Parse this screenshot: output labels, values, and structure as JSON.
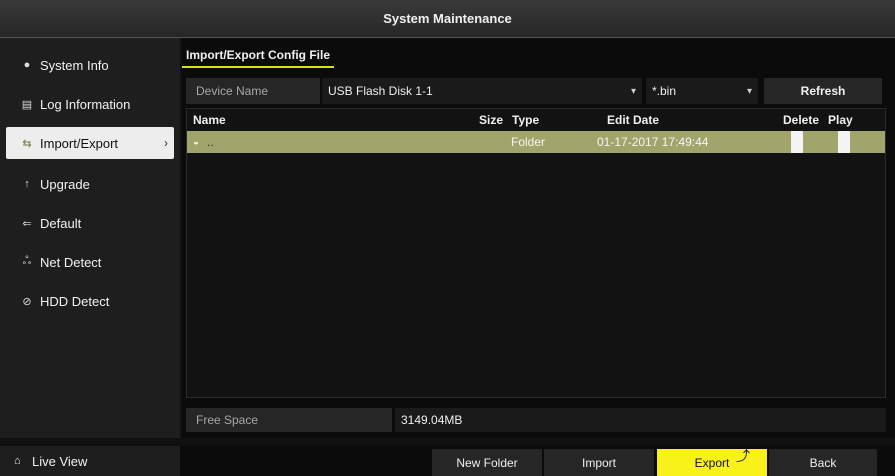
{
  "window": {
    "title": "System Maintenance"
  },
  "sidebar": {
    "items": [
      {
        "icon": "info-dot-icon",
        "glyph": "●",
        "label": "System Info",
        "active": false
      },
      {
        "icon": "log-icon",
        "glyph": "▤",
        "label": "Log Information",
        "active": false
      },
      {
        "icon": "import-export-icon",
        "glyph": "⇆",
        "label": "Import/Export",
        "active": true
      },
      {
        "icon": "upgrade-icon",
        "glyph": "↑",
        "label": "Upgrade",
        "active": false
      },
      {
        "icon": "default-icon",
        "glyph": "⇐",
        "label": "Default",
        "active": false
      },
      {
        "icon": "net-detect-icon",
        "glyph": "ஃ",
        "label": "Net Detect",
        "active": false
      },
      {
        "icon": "hdd-detect-icon",
        "glyph": "⊘",
        "label": "HDD Detect",
        "active": false
      }
    ],
    "live_view": {
      "icon": "home-icon",
      "glyph": "⌂",
      "label": "Live View"
    }
  },
  "subtab": {
    "label": "Import/Export Config File"
  },
  "device": {
    "label": "Device Name",
    "selected": "USB Flash Disk 1-1",
    "extension": "*.bin",
    "refresh_label": "Refresh"
  },
  "table": {
    "headers": {
      "name": "Name",
      "size": "Size",
      "type": "Type",
      "edit_date": "Edit Date",
      "delete": "Delete",
      "play": "Play"
    },
    "rows": [
      {
        "icon": "folder-icon",
        "name": "..",
        "size": "",
        "type": "Folder",
        "edit_date": "01-17-2017 17:49:44"
      }
    ]
  },
  "free_space": {
    "label": "Free Space",
    "value": "3149.04MB"
  },
  "actions": {
    "new_folder": "New Folder",
    "import": "Import",
    "export": "Export",
    "back": "Back"
  },
  "colors": {
    "accent": "#f8f21a",
    "selected_row": "#a2a56b",
    "tab_underline": "#d6e01a"
  }
}
